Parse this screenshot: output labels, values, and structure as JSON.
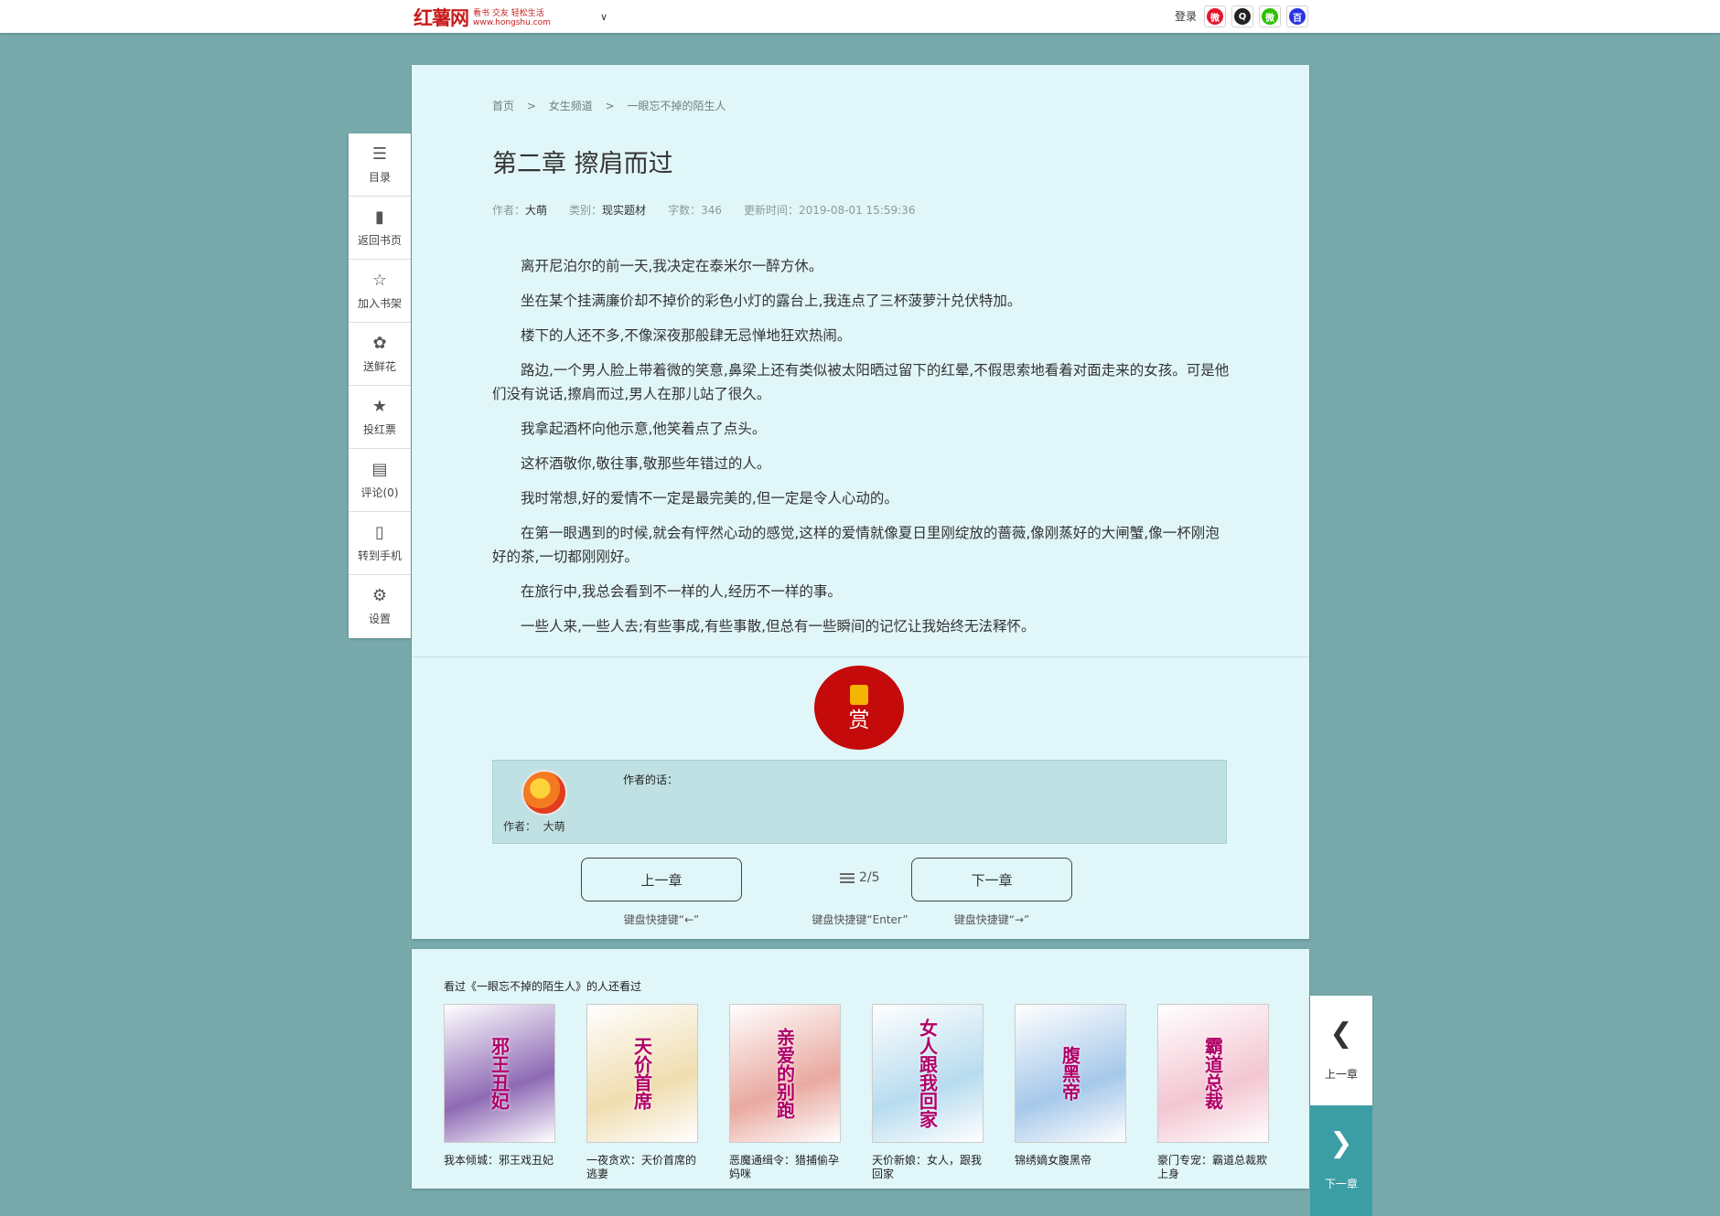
{
  "header": {
    "logo_main": "红薯网",
    "logo_tagline": "看书 交友 轻松生活",
    "logo_url": "www.hongshu.com",
    "login": "登录",
    "social_icons": [
      "weibo-icon",
      "qq-icon",
      "wechat-icon",
      "baidu-icon"
    ]
  },
  "breadcrumb": {
    "items": [
      "首页",
      "女生频道",
      "一眼忘不掉的陌生人"
    ],
    "separator": ">"
  },
  "chapter": {
    "title": "第二章 擦肩而过",
    "author_label": "作者：",
    "author": "大萌",
    "category_label": "类别：",
    "category": "现实题材",
    "word_count_label": "字数：",
    "word_count": "346",
    "updated_label": "更新时间：",
    "updated": "2019-08-01 15:59:36",
    "paragraphs": [
      "离开尼泊尔的前一天,我决定在泰米尔一醉方休。",
      "坐在某个挂满廉价却不掉价的彩色小灯的露台上,我连点了三杯菠萝汁兑伏特加。",
      "楼下的人还不多,不像深夜那般肆无忌惮地狂欢热闹。",
      "路边,一个男人脸上带着微的笑意,鼻梁上还有类似被太阳晒过留下的红晕,不假思索地看着对面走来的女孩。可是他们没有说话,擦肩而过,男人在那儿站了很久。",
      "我拿起酒杯向他示意,他笑着点了点头。",
      "这杯酒敬你,敬往事,敬那些年错过的人。",
      "我时常想,好的爱情不一定是最完美的,但一定是令人心动的。",
      "在第一眼遇到的时候,就会有怦然心动的感觉,这样的爱情就像夏日里刚绽放的蔷薇,像刚蒸好的大闸蟹,像一杯刚泡好的茶,一切都刚刚好。",
      "在旅行中,我总会看到不一样的人,经历不一样的事。",
      "一些人来,一些人去;有些事成,有些事散,但总有一些瞬间的记忆让我始终无法释怀。"
    ]
  },
  "reward": {
    "label": "赏"
  },
  "author_note": {
    "label": "作者的话：",
    "author_label": "作者：",
    "author": "大萌"
  },
  "nav": {
    "prev_label": "上一章",
    "prev_hint": "键盘快捷键“←”",
    "pager": "2/5",
    "pager_hint": "键盘快捷键“Enter”",
    "next_label": "下一章",
    "next_hint": "键盘快捷键“→”"
  },
  "recommend": {
    "title": "看过《一眼忘不掉的陌生人》的人还看过",
    "books": [
      {
        "name": "我本倾城：邪王戏丑妃",
        "cover_text": "邪王丑妃",
        "color": "#8e6ab5"
      },
      {
        "name": "一夜贪欢：天价首席的逃妻",
        "cover_text": "天价首席",
        "color": "#f0ddb0"
      },
      {
        "name": "恶魔通缉令：猎捕偷孕妈咪",
        "cover_text": "亲爱的别跑",
        "color": "#e9a9a0"
      },
      {
        "name": "天价新娘：女人，跟我回家",
        "cover_text": "女人跟我回家",
        "color": "#b7dcef"
      },
      {
        "name": "锦绣嫡女腹黑帝",
        "cover_text": "腹黑帝",
        "color": "#a6c8ea"
      },
      {
        "name": "豪门专宠：霸道总裁欺上身",
        "cover_text": "霸道总裁",
        "color": "#f3c6d2"
      }
    ]
  },
  "sidebar": [
    {
      "label": "目录",
      "icon": "list-icon",
      "glyph": "☰"
    },
    {
      "label": "返回书页",
      "icon": "book-icon",
      "glyph": "▮"
    },
    {
      "label": "加入书架",
      "icon": "star-icon",
      "glyph": "☆"
    },
    {
      "label": "送鲜花",
      "icon": "flower-icon",
      "glyph": "✿"
    },
    {
      "label": "投红票",
      "icon": "ticket-icon",
      "glyph": "★"
    },
    {
      "label": "评论(0)",
      "icon": "comment-icon",
      "glyph": "▤"
    },
    {
      "label": "转到手机",
      "icon": "phone-icon",
      "glyph": "▯"
    },
    {
      "label": "设置",
      "icon": "gear-icon",
      "glyph": "⚙"
    }
  ],
  "float_nav": {
    "prev_label": "上一章",
    "next_label": "下一章"
  },
  "colors": {
    "background": "#78a9ab",
    "panel": "#e0f6f8",
    "brand_red": "#c91c1c",
    "reward_red": "#c40a0a",
    "next_button": "#3b9ea4"
  }
}
